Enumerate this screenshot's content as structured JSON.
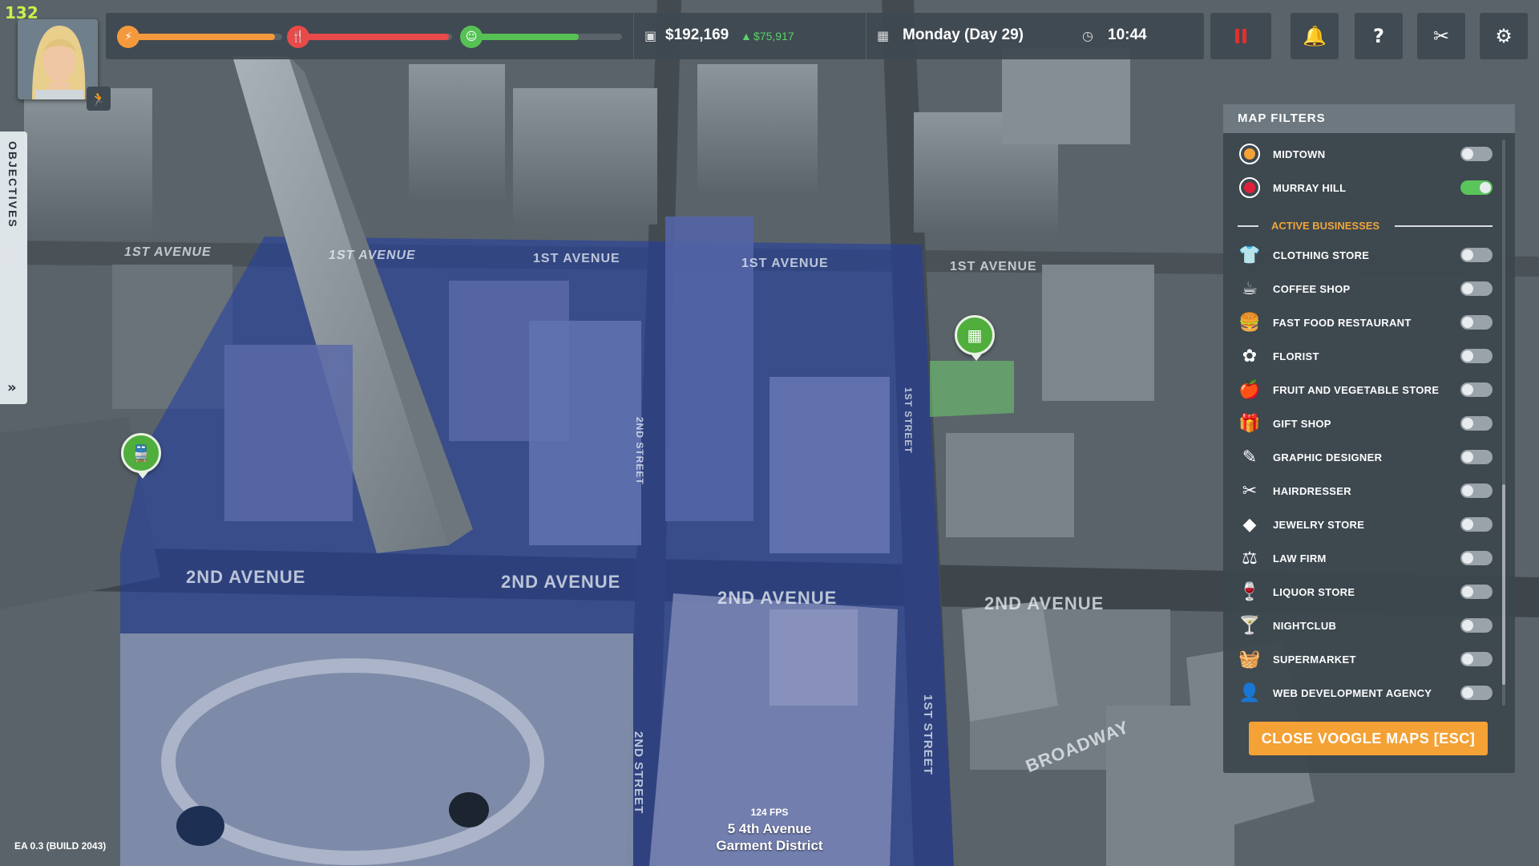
{
  "hud": {
    "corner_fps": "132",
    "money": "$192,169",
    "money_change": "$75,917",
    "day": "Monday (Day 29)",
    "time": "10:44",
    "bars": {
      "energy": 0.95,
      "hunger": 0.98,
      "happiness": 0.7
    },
    "colors": {
      "energy": "#f49a3c",
      "hunger": "#e94a4a",
      "happiness": "#56c254"
    }
  },
  "objectives": {
    "label": "OBJECTIVES",
    "toggle_icon": "double-chevron-right-icon"
  },
  "filters": {
    "title": "MAP FILTERS",
    "districts": [
      {
        "label": "MIDTOWN",
        "icon": "midtown-marker-icon",
        "on": false
      },
      {
        "label": "MURRAY HILL",
        "icon": "murray-hill-marker-icon",
        "on": true
      }
    ],
    "section_label": "ACTIVE BUSINESSES",
    "businesses": [
      {
        "label": "CLOTHING STORE",
        "icon": "shirt-icon",
        "on": false
      },
      {
        "label": "COFFEE SHOP",
        "icon": "coffee-cup-icon",
        "on": false
      },
      {
        "label": "FAST FOOD RESTAURANT",
        "icon": "burger-icon",
        "on": false
      },
      {
        "label": "FLORIST",
        "icon": "flower-shop-icon",
        "on": false
      },
      {
        "label": "FRUIT AND VEGETABLE STORE",
        "icon": "produce-icon",
        "on": false
      },
      {
        "label": "GIFT SHOP",
        "icon": "gift-icon",
        "on": false
      },
      {
        "label": "GRAPHIC DESIGNER",
        "icon": "design-icon",
        "on": false
      },
      {
        "label": "HAIRDRESSER",
        "icon": "scissors-icon",
        "on": false
      },
      {
        "label": "JEWELRY STORE",
        "icon": "diamond-icon",
        "on": false
      },
      {
        "label": "LAW FIRM",
        "icon": "gavel-icon",
        "on": false
      },
      {
        "label": "LIQUOR STORE",
        "icon": "wine-glass-icon",
        "on": false
      },
      {
        "label": "NIGHTCLUB",
        "icon": "cocktail-icon",
        "on": false
      },
      {
        "label": "SUPERMARKET",
        "icon": "shopping-basket-icon",
        "on": false
      },
      {
        "label": "WEB DEVELOPMENT AGENCY",
        "icon": "developer-icon",
        "on": false
      }
    ],
    "close_label": "CLOSE VOOGLE MAPS [ESC]"
  },
  "streets": {
    "first_avenue": "1ST AVENUE",
    "second_avenue": "2ND AVENUE",
    "first_street": "1ST STREET",
    "second_street": "2ND STREET",
    "broadway": "BROADWAY"
  },
  "footer": {
    "build": "EA 0.3 (BUILD 2043)",
    "fps": "124 FPS",
    "address_line1": "5 4th Avenue",
    "address_line2": "Garment District"
  }
}
